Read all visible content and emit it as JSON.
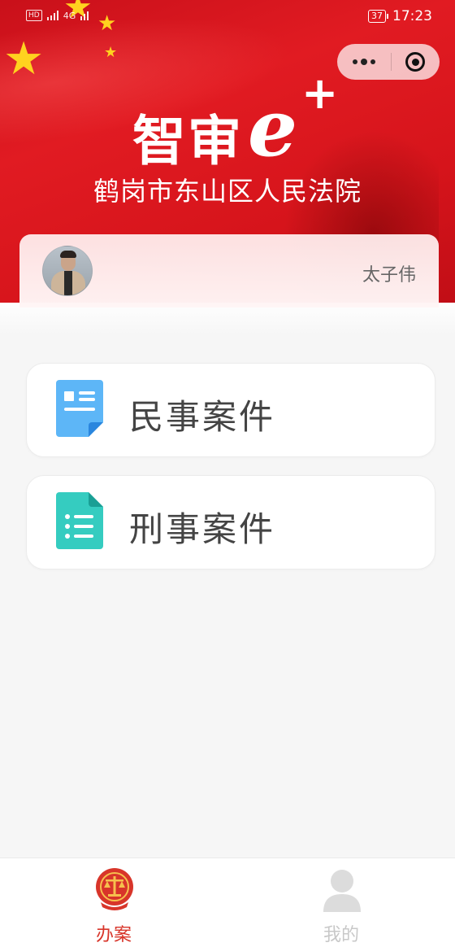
{
  "status_bar": {
    "network_badge": "HD",
    "network_type": "4G",
    "battery": "37",
    "time": "17:23"
  },
  "capsule": {
    "more_icon": "more-dots-icon",
    "close_icon": "target-close-icon"
  },
  "header": {
    "logo_text": "智审",
    "logo_e": "e",
    "logo_plus": "+",
    "court_name": "鹤岗市东山区人民法院"
  },
  "user": {
    "name": "太子伟"
  },
  "cases": [
    {
      "label": "民事案件",
      "icon": "document-icon",
      "color": "#5db6f7"
    },
    {
      "label": "刑事案件",
      "icon": "list-document-icon",
      "color": "#35ccc0"
    }
  ],
  "tabbar": {
    "items": [
      {
        "label": "办案",
        "icon": "court-emblem-icon",
        "active": true
      },
      {
        "label": "我的",
        "icon": "person-icon",
        "active": false
      }
    ]
  },
  "colors": {
    "banner_red": "#e11b22",
    "active_tab": "#d8352a",
    "inactive_tab": "#c8c8c8"
  }
}
